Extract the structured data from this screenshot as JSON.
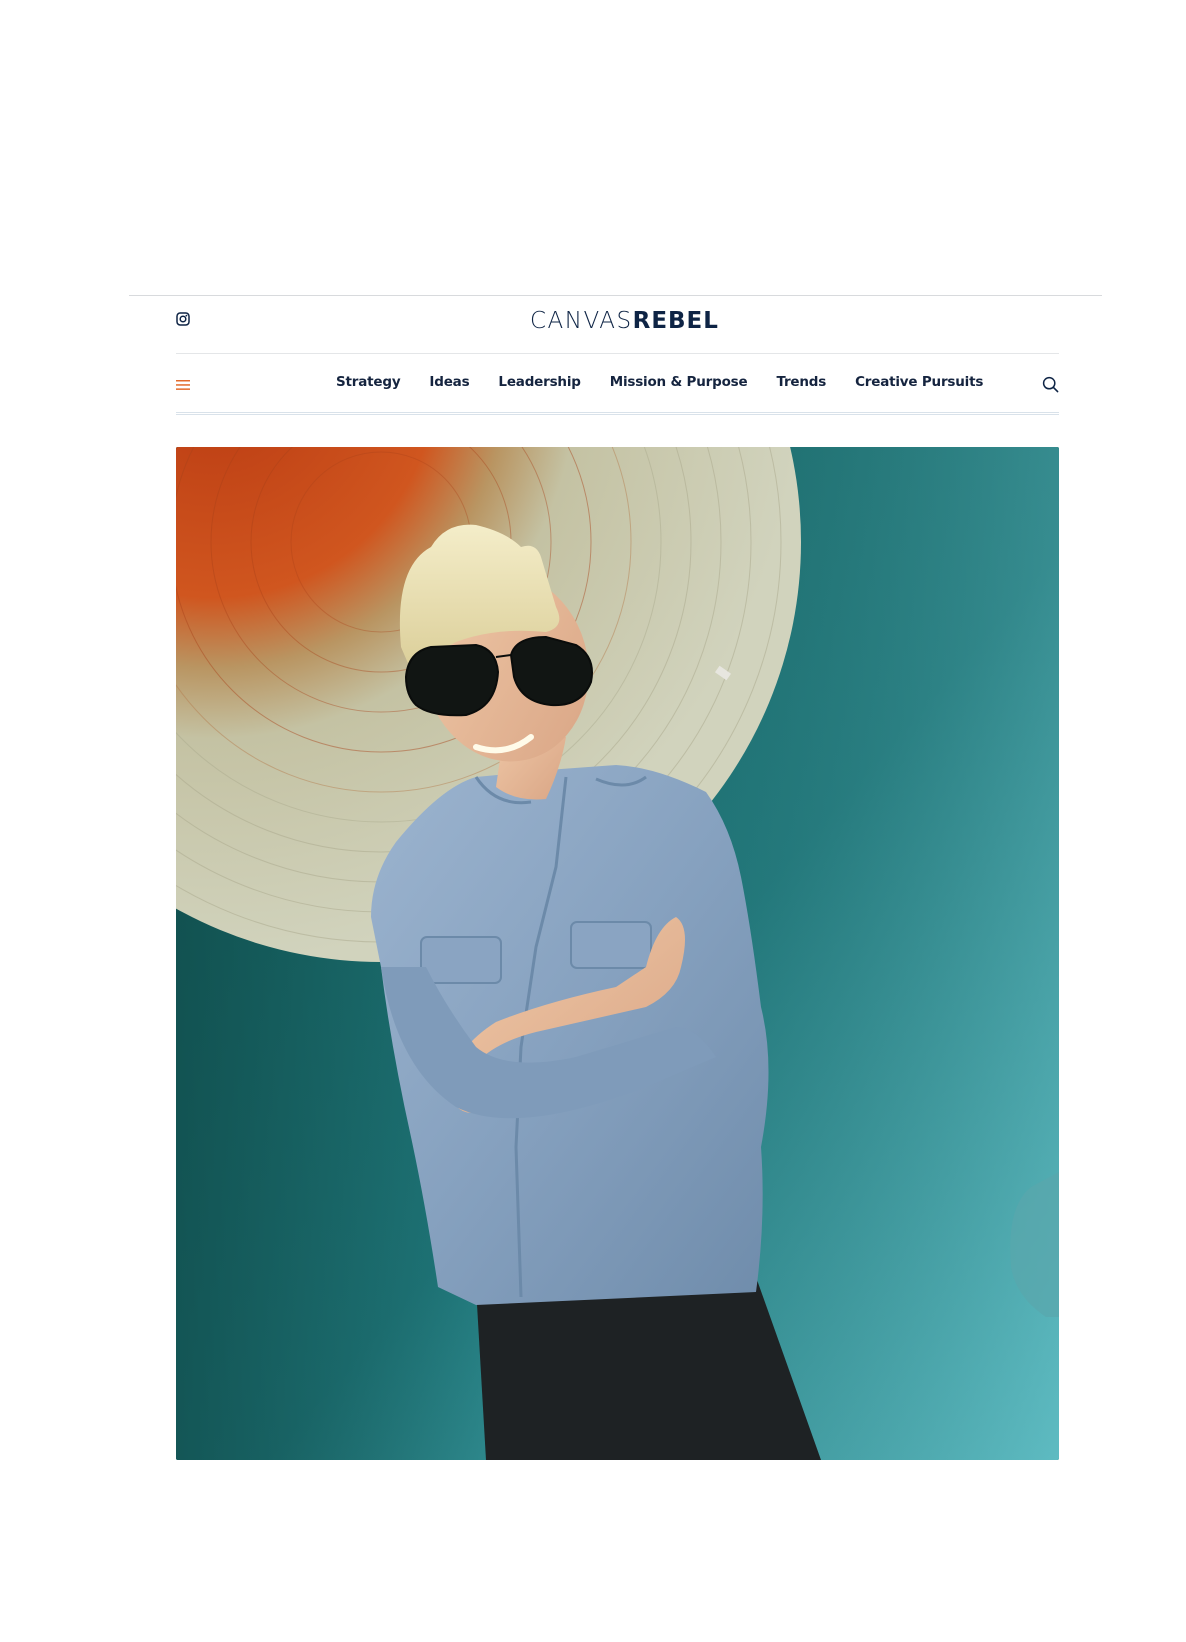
{
  "header": {
    "logo": {
      "light": "CANVAS",
      "bold": "REBEL"
    },
    "social": {
      "icon": "instagram-icon"
    },
    "menu": {
      "icon": "hamburger-menu-icon"
    },
    "search": {
      "icon": "search-icon"
    }
  },
  "nav": {
    "items": [
      {
        "label": "Strategy"
      },
      {
        "label": "Ideas"
      },
      {
        "label": "Leadership"
      },
      {
        "label": "Mission & Purpose"
      },
      {
        "label": "Trends"
      },
      {
        "label": "Creative Pursuits"
      }
    ]
  },
  "colors": {
    "brand_navy": "#0e2445",
    "accent_orange": "#e36b2c",
    "wall_teal": "#1f7679",
    "disc_orange": "#c8461a",
    "disc_cream": "#c8c6a8",
    "denim_blue": "#8fa8c4"
  }
}
